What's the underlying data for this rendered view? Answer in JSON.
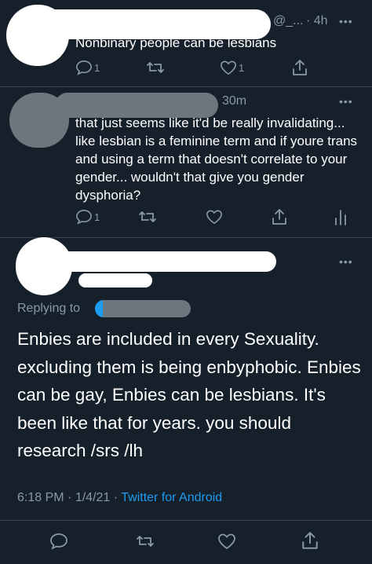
{
  "tweet1": {
    "handle_fragment": "@_...",
    "time": "· 4h",
    "text": "Nonbinary people can be lesbians",
    "reply_count": "1",
    "like_count": "1"
  },
  "tweet2": {
    "time": "30m",
    "text": "that just seems like it'd be really invalidating... like lesbian is a feminine term and if youre trans and using a term that doesn't correlate to your gender... wouldn't that give you gender dysphoria?",
    "reply_count": "1"
  },
  "focused_tweet": {
    "replying_label": "Replying to",
    "text": "Enbies are included in every Sexuality. excluding them is being enbyphobic. Enbies can be gay, Enbies can be lesbians. It's been like that for years. you should research /srs /lh",
    "time": "6:18 PM",
    "date": "1/4/21",
    "client": "Twitter for Android"
  },
  "more_glyph": "•••",
  "colors": {
    "background": "#15202b",
    "muted": "#8b98a5",
    "link": "#1d9bf0",
    "divider": "#38444d"
  }
}
